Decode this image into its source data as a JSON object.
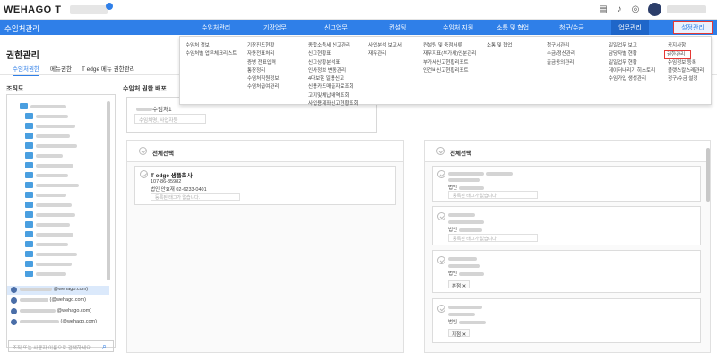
{
  "brand": {
    "logo": "WEHAGO T"
  },
  "nav": {
    "title": "수임처관리",
    "items": [
      "수임처관리",
      "기장업무",
      "신고업무",
      "컨설팅",
      "수임처 지원",
      "소통 및 협업",
      "청구/수금",
      "업무관리",
      "설정관리"
    ]
  },
  "mega_menu": {
    "columns": [
      [
        "수임처 정보",
        "수임처별 업무체크리스트"
      ],
      [
        "기장진도현황",
        "자동전표처리",
        "증빙 전표입력",
        "통장정리",
        "수임처직원정보",
        "수임처급여관리"
      ],
      [
        "종합소득세 신고관리",
        "신고현황표",
        "신고상황분석표",
        "인사정보 변동관리",
        "4대보험 일용신고",
        "신용카드매출자료조회",
        "고지및체납내역조회",
        "사업용계좌신고현황조회"
      ],
      [
        "사업분석 보고서",
        "재무관리"
      ],
      [
        "컨설팅 및 중점서류",
        "재무지표(부가세)안분관리",
        "부가세신고현황리포트",
        "인건비신고현황리포트"
      ],
      [
        "소통 및 협업"
      ],
      [
        "청구서관리",
        "수금/정산관리",
        "출금동의관리"
      ],
      [
        "일일업무 보고",
        "담당자별 현황",
        "일일업무 현황",
        "데이터내리기 히스토리",
        "수임가입 생성관리"
      ],
      [
        "공지사항",
        "권한관리",
        "수임정보 등록",
        "플랫스칼스레관리",
        "청구/수금 설정"
      ]
    ]
  },
  "page": {
    "title": "권한관리"
  },
  "tabs": [
    "수임처권한",
    "메뉴권한",
    "T edge 메뉴 권한관리"
  ],
  "org": {
    "label": "조직도",
    "users": [
      {
        "email": "@wehago.com)"
      },
      {
        "email": "(@wehago.com)"
      },
      {
        "email": "@wehago.com)"
      },
      {
        "email": "(@wehago.com)"
      }
    ],
    "search_placeholder": "조직 또는 사용자 이름으로 검색하세요."
  },
  "deploy": {
    "title": "수임처 권한 배포",
    "company_name_suffix": "수임처1",
    "search_placeholder": "수임처명, 사업자등"
  },
  "left_column": {
    "select_all": "전체선택",
    "card": {
      "title": "T edge 생플회사",
      "biz_no": "107-86-35982",
      "rep_label": "법인",
      "rep_name": "안효재",
      "phone": "02-6233-0401",
      "tag_placeholder": "등록된 태그가 없습니다."
    }
  },
  "right_column": {
    "select_all": "전체선택",
    "cards": [
      {
        "rep_label": "법인",
        "tag_placeholder": "등록된 태그가 없습니다.",
        "tag": ""
      },
      {
        "rep_label": "법인",
        "tag_placeholder": "등록된 태그가 없습니다.",
        "tag": ""
      },
      {
        "rep_label": "법인",
        "tag_placeholder": "",
        "tag": "본점"
      },
      {
        "rep_label": "법인",
        "tag_placeholder": "",
        "tag": "지점"
      }
    ]
  },
  "colors": {
    "primary": "#2f7fe8",
    "highlight": "#e53935"
  }
}
